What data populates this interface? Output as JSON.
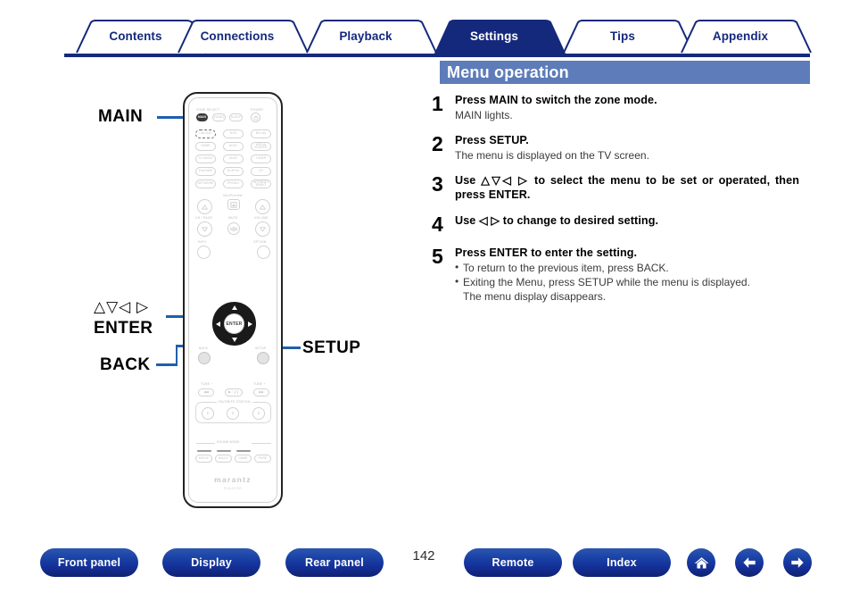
{
  "tabs": [
    {
      "label": "Contents",
      "active": false
    },
    {
      "label": "Connections",
      "active": false
    },
    {
      "label": "Playback",
      "active": false
    },
    {
      "label": "Settings",
      "active": true
    },
    {
      "label": "Tips",
      "active": false
    },
    {
      "label": "Appendix",
      "active": false
    }
  ],
  "heading": {
    "title": "Menu operation"
  },
  "steps": [
    {
      "num": "1",
      "title": "Press MAIN to switch the zone mode.",
      "sub": "MAIN lights.",
      "bullets": []
    },
    {
      "num": "2",
      "title": "Press SETUP.",
      "sub": "The menu is displayed on the TV screen.",
      "bullets": []
    },
    {
      "num": "3",
      "title": "Use △▽◁ ▷ to select the menu to be set or operated, then press ENTER.",
      "sub": "",
      "bullets": []
    },
    {
      "num": "4",
      "title": "Use ◁ ▷ to change to desired setting.",
      "sub": "",
      "bullets": []
    },
    {
      "num": "5",
      "title": "Press ENTER to enter the setting.",
      "sub": "",
      "bullets": [
        {
          "text": "To return to the previous item, press BACK.",
          "bullet": true
        },
        {
          "text": "Exiting the Menu, press SETUP while the menu is displayed.",
          "bullet": true
        },
        {
          "text": "The menu display disappears.",
          "bullet": false
        }
      ]
    }
  ],
  "callouts": {
    "main": "MAIN",
    "cursor_symbols": "△▽◁ ▷",
    "enter": "ENTER",
    "back": "BACK",
    "setup": "SETUP"
  },
  "remote": {
    "zone_select_label": "ZONE SELECT",
    "power_label": "POWER",
    "zone_buttons": [
      {
        "label": "MAIN",
        "state": "highlighted"
      },
      {
        "label": "ZONE2",
        "state": "normal"
      },
      {
        "label": "SLEEP",
        "state": "normal"
      }
    ],
    "power_button": "power-icon",
    "source_buttons": [
      {
        "label": "CBL/SAT",
        "state": "dashed"
      },
      {
        "label": "DVD",
        "state": "normal"
      },
      {
        "label": "Blu-ray",
        "state": "normal"
      },
      {
        "label": "GAME",
        "state": "normal"
      },
      {
        "label": "AUX1",
        "state": "normal"
      },
      {
        "label": "MEDIA PLAYER",
        "state": "normal"
      },
      {
        "label": "TV AUDIO",
        "state": "normal"
      },
      {
        "label": "AUX2",
        "state": "normal"
      },
      {
        "label": "TUNER",
        "state": "normal"
      },
      {
        "label": "Pod/USB",
        "state": "normal"
      },
      {
        "label": "M-XPort",
        "state": "normal"
      },
      {
        "label": "CD",
        "state": "normal"
      },
      {
        "label": "NETWORK",
        "state": "normal"
      },
      {
        "label": "PHONO",
        "state": "normal"
      },
      {
        "label": "INTERNET RADIO",
        "state": "normal"
      }
    ],
    "ch_page_label": "CH / PAGE",
    "volume_label": "VOLUME",
    "mute_label": "MUTE",
    "info_preview_label": "Info/Preview",
    "info_label": "INFO",
    "option_label": "OPTION",
    "enter_label": "ENTER",
    "back_label": "BACK",
    "setup_label": "SETUP",
    "tune_minus_label": "TUNE −",
    "tune_plus_label": "TUNE +",
    "favorite_station_label": "FAVORITE STATION",
    "favorite_buttons": [
      "1",
      "2",
      "3"
    ],
    "transport_buttons": [
      "◀◀",
      "▶ / ❙❙",
      "▶▶"
    ],
    "sound_mode_label": "SOUND MODE",
    "sound_mode_buttons": [
      "MOVIE",
      "MUSIC",
      "GAME",
      "PURE"
    ],
    "brand": "marantz",
    "model": "RC022SR"
  },
  "footer": {
    "buttons": [
      {
        "label": "Front panel"
      },
      {
        "label": "Display"
      },
      {
        "label": "Rear panel"
      },
      {
        "label": "Remote"
      },
      {
        "label": "Index"
      }
    ],
    "page_number": "142",
    "icon_buttons": [
      {
        "name": "home-icon"
      },
      {
        "name": "arrow-left-icon"
      },
      {
        "name": "arrow-right-icon"
      }
    ]
  },
  "colors": {
    "navy": "#15297c",
    "heading_blue": "#5d7cb9",
    "leader_blue": "#1f5fae",
    "pill_blue": "#1840a4"
  }
}
